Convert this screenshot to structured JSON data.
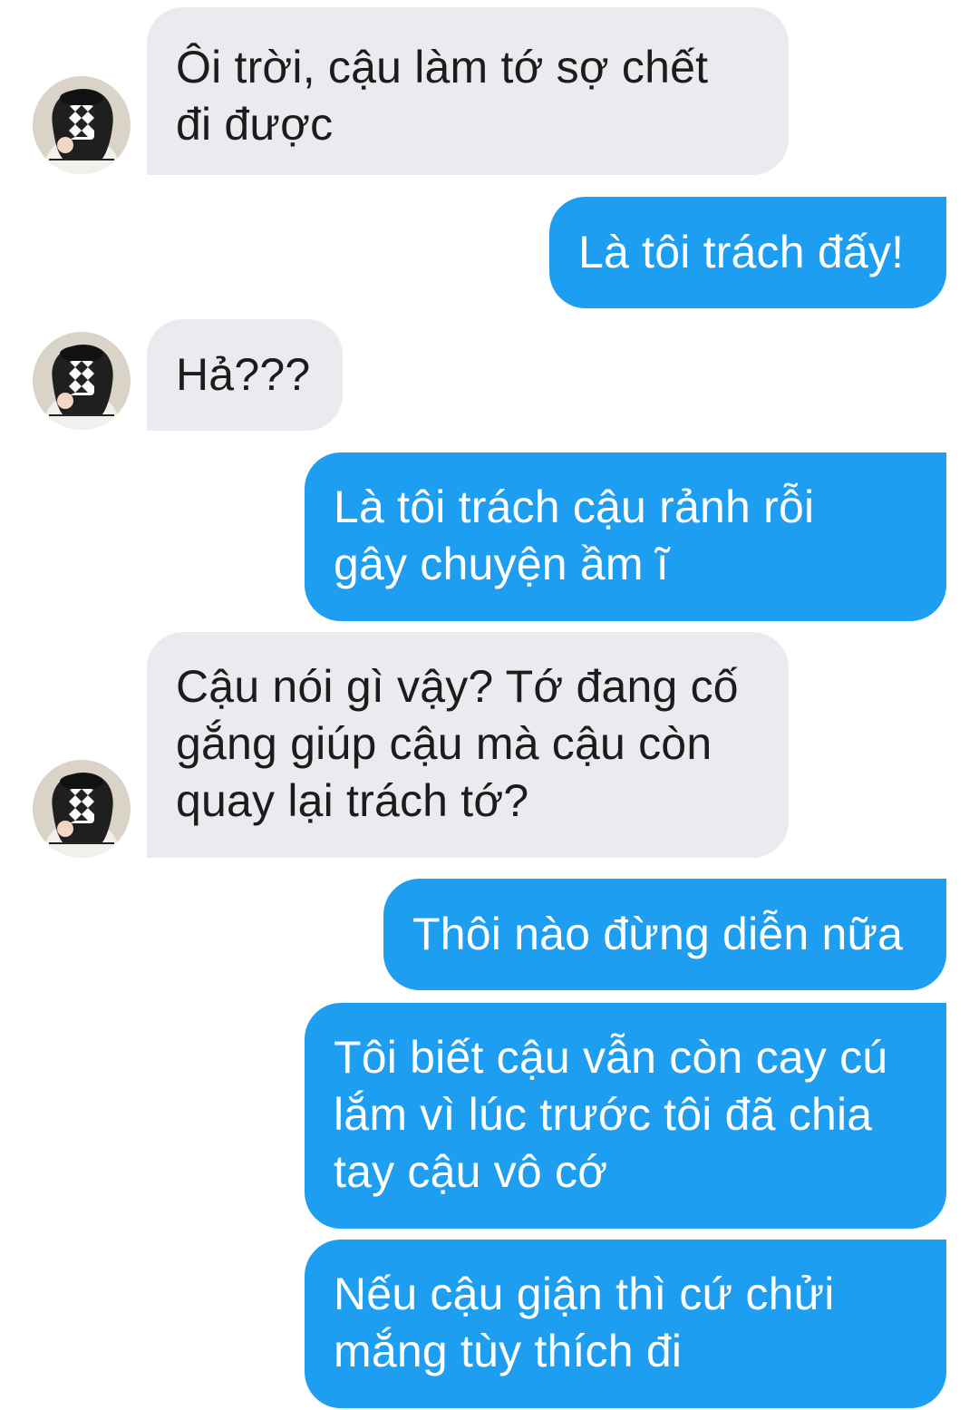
{
  "conversation": {
    "messages": [
      {
        "from": "contact",
        "lines": [
          "Ôi trời, cậu làm tớ sợ chết",
          "đi được"
        ]
      },
      {
        "from": "me",
        "lines": [
          "Là tôi trách đấy!"
        ]
      },
      {
        "from": "contact",
        "lines": [
          "Hả???"
        ]
      },
      {
        "from": "me",
        "lines": [
          "Là tôi trách cậu rảnh rỗi",
          "gây chuyện ầm ĩ"
        ]
      },
      {
        "from": "contact",
        "lines": [
          "Cậu nói gì vậy? Tớ đang cố",
          "gắng giúp cậu mà cậu còn",
          "quay lại trách tớ?"
        ]
      },
      {
        "from": "me",
        "lines": [
          "Thôi nào đừng diễn nữa"
        ]
      },
      {
        "from": "me",
        "lines": [
          "Tôi biết cậu vẫn còn cay cú",
          "lắm vì lúc trước tôi đã chia",
          "tay cậu vô cớ"
        ]
      },
      {
        "from": "me",
        "lines": [
          "Nếu cậu giận thì cứ chửi",
          "mắng tùy thích đi"
        ]
      }
    ]
  },
  "colors": {
    "incoming_bubble": "#e9ebee",
    "outgoing_bubble": "#1e9ef0",
    "incoming_text": "#1c1c1c",
    "outgoing_text": "#ffffff"
  },
  "icons": {
    "avatar": "contact-avatar-photo"
  }
}
